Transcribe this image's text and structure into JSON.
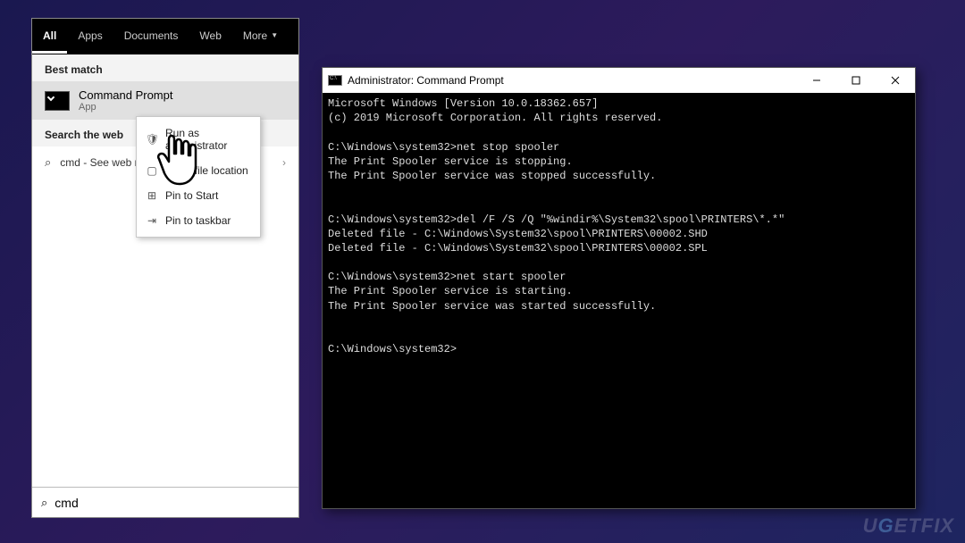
{
  "start": {
    "tabs": [
      "All",
      "Apps",
      "Documents",
      "Web",
      "More"
    ],
    "active_tab": "All",
    "best_match_label": "Best match",
    "best_match": {
      "title": "Command Prompt",
      "subtitle": "App"
    },
    "web_label": "Search the web",
    "web_query_display": "cmd - See web results",
    "search_value": "cmd"
  },
  "context_menu": {
    "items": [
      {
        "icon": "admin-icon",
        "label": "Run as administrator"
      },
      {
        "icon": "folder-icon",
        "label": "Open file location"
      },
      {
        "icon": "pin-start-icon",
        "label": "Pin to Start"
      },
      {
        "icon": "pin-taskbar-icon",
        "label": "Pin to taskbar"
      }
    ]
  },
  "cmd_window": {
    "title": "Administrator: Command Prompt",
    "lines": [
      "Microsoft Windows [Version 10.0.18362.657]",
      "(c) 2019 Microsoft Corporation. All rights reserved.",
      "",
      "C:\\Windows\\system32>net stop spooler",
      "The Print Spooler service is stopping.",
      "The Print Spooler service was stopped successfully.",
      "",
      "",
      "C:\\Windows\\system32>del /F /S /Q \"%windir%\\System32\\spool\\PRINTERS\\*.*\"",
      "Deleted file - C:\\Windows\\System32\\spool\\PRINTERS\\00002.SHD",
      "Deleted file - C:\\Windows\\System32\\spool\\PRINTERS\\00002.SPL",
      "",
      "C:\\Windows\\system32>net start spooler",
      "The Print Spooler service is starting.",
      "The Print Spooler service was started successfully.",
      "",
      "",
      "C:\\Windows\\system32>"
    ]
  },
  "watermark": {
    "pre": "U",
    "accent": "G",
    "post": "ETFIX"
  }
}
